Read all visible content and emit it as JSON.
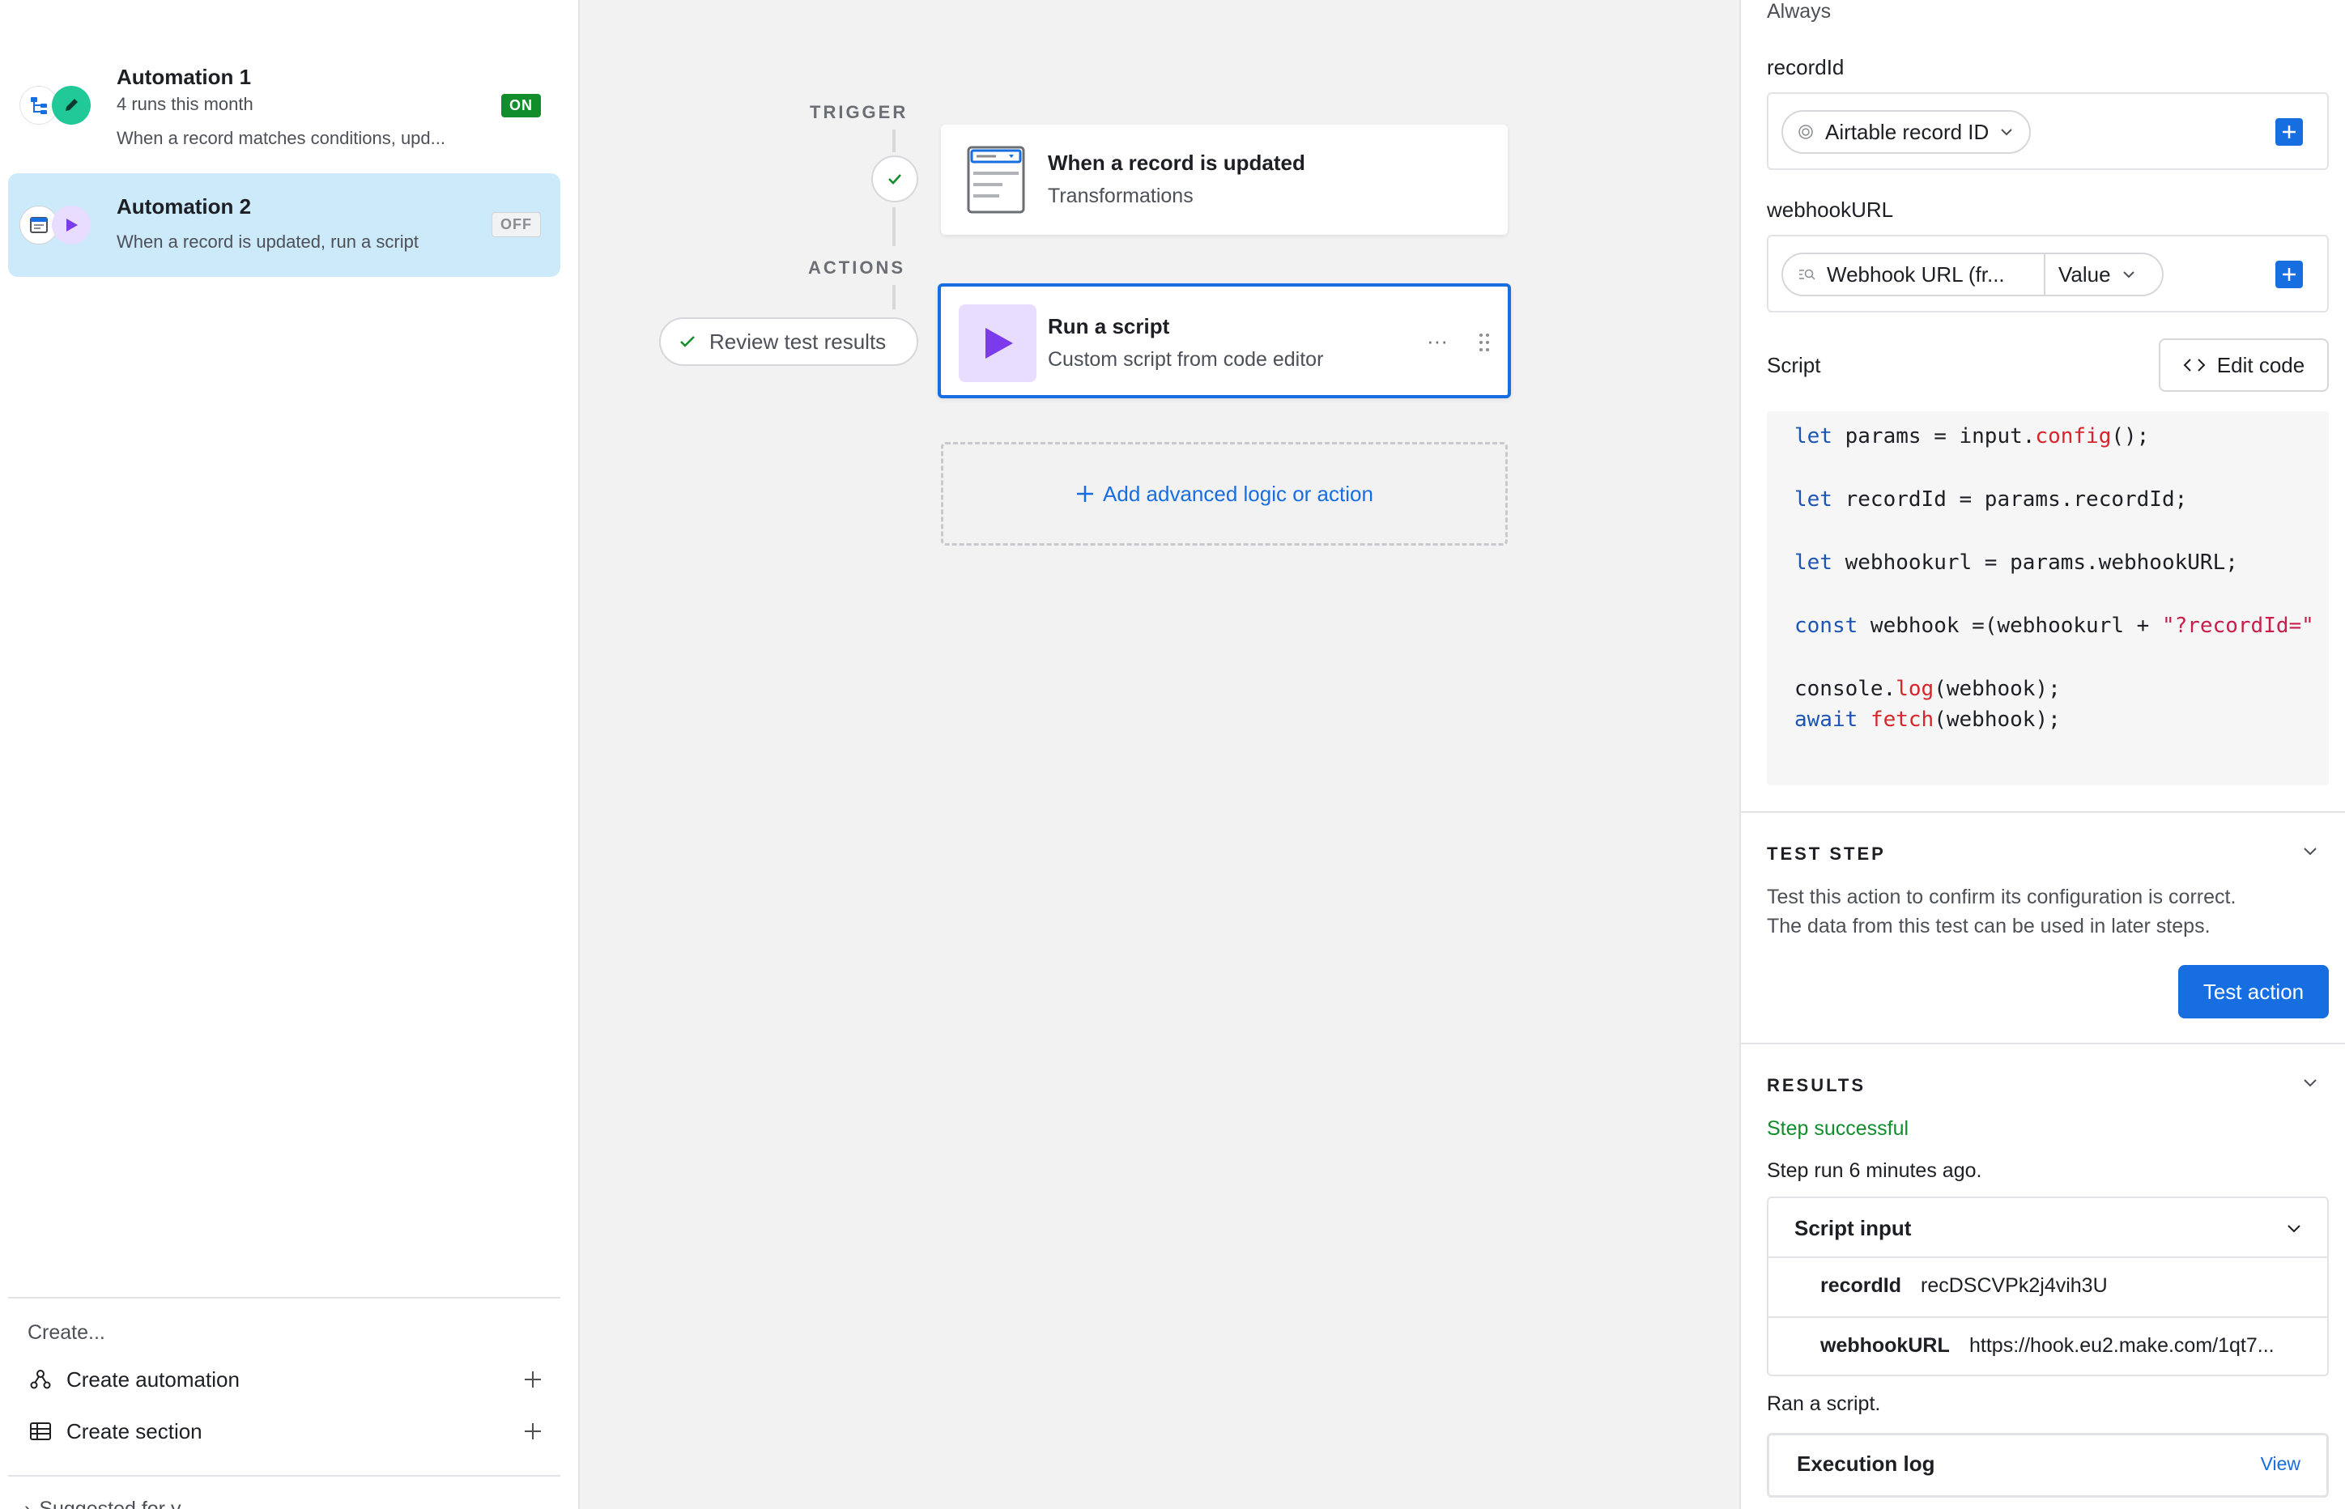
{
  "sidebar": {
    "automations": [
      {
        "name": "Automation 1",
        "runs": "4 runs this month",
        "description": "When a record matches conditions, upd...",
        "status": "ON"
      },
      {
        "name": "Automation 2",
        "description": "When a record is updated, run a script",
        "status": "OFF"
      }
    ],
    "create_label": "Create...",
    "create_automation": "Create automation",
    "create_section": "Create section",
    "suggested_label": "Suggested for y..."
  },
  "canvas": {
    "trigger_label": "TRIGGER",
    "actions_label": "ACTIONS",
    "trigger_card": {
      "title": "When a record is updated",
      "subtitle": "Transformations"
    },
    "action_card": {
      "title": "Run a script",
      "subtitle": "Custom script from code editor"
    },
    "review_button": "Review test results",
    "add_button": "Add advanced logic or action"
  },
  "panel": {
    "always_text": "Always",
    "record_id_label": "recordId",
    "record_id_token": "Airtable record ID",
    "webhook_label": "webhookURL",
    "webhook_token": "Webhook URL (fr...",
    "webhook_value_token": "Value",
    "script_label": "Script",
    "edit_code": "Edit code",
    "code": {
      "line1": {
        "kw": "let",
        "a": " params = input.",
        "fn": "config",
        "b": "();"
      },
      "line2": {
        "kw": "let",
        "a": " recordId = params.recordId;"
      },
      "line3": {
        "kw": "let",
        "a": " webhookurl = params.webhookURL;"
      },
      "line4": {
        "kw": "const",
        "a": " webhook =(webhookurl + ",
        "str": "\"?recordId=\""
      },
      "line5": {
        "a": "console.",
        "fn": "log",
        "b": "(webhook);"
      },
      "line6": {
        "kw": "await",
        "a": " ",
        "fn": "fetch",
        "b": "(webhook);"
      }
    },
    "test_step": {
      "heading": "TEST STEP",
      "line1": "Test this action to confirm its configuration is correct.",
      "line2": "The data from this test can be used in later steps.",
      "button": "Test action"
    },
    "results": {
      "heading": "RESULTS",
      "status": "Step successful",
      "time": "Step run 6 minutes ago.",
      "script_input_label": "Script input",
      "rows": [
        {
          "key": "recordId",
          "value": "recDSCVPk2j4vih3U"
        },
        {
          "key": "webhookURL",
          "value": "https://hook.eu2.make.com/1qt7..."
        }
      ],
      "ran_text": "Ran a script.",
      "execution_log": "Execution log",
      "view_link": "View"
    }
  },
  "colors": {
    "accent": "#166ee1",
    "success": "#118d2c",
    "selected_bg": "#cdeafb",
    "script_purple": "#7c3aed"
  }
}
